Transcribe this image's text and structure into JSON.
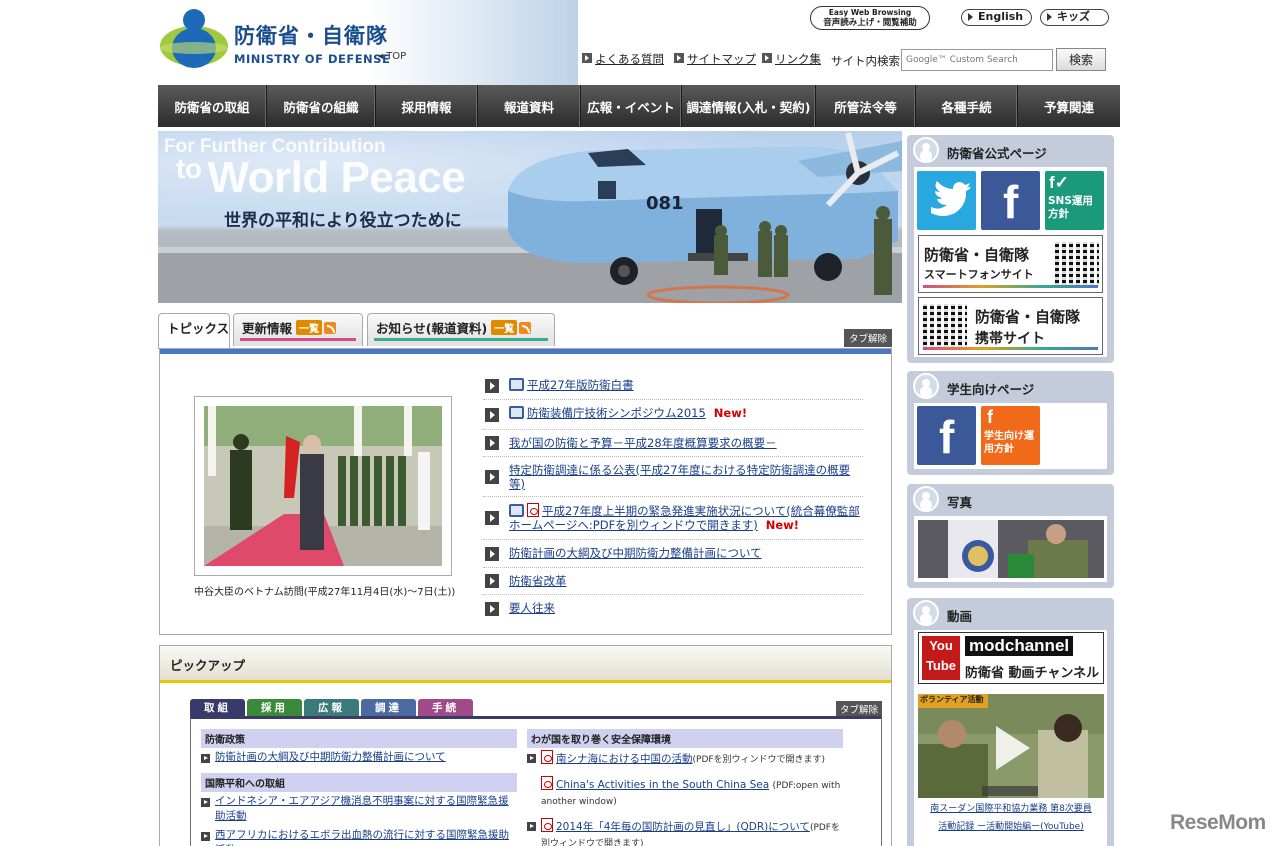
{
  "header": {
    "logo_jp": "防衛省・自衛隊",
    "logo_en": "MINISTRY OF DEFENSE",
    "top_link": "◂ TOP",
    "easy_web_line1": "Easy Web Browsing",
    "easy_web_line2": "音声読み上げ・閲覧補助",
    "english": "English",
    "kids": "キッズ",
    "links": [
      "よくある質問",
      "サイトマップ",
      "リンク集"
    ],
    "search_label": "サイト内検索",
    "search_placeholder": "Google™ Custom Search",
    "search_button": "検索"
  },
  "nav": [
    "防衛省の取組",
    "防衛省の組織",
    "採用情報",
    "報道資料",
    "広報・イベント",
    "調達情報(入札・契約)",
    "所管法令等",
    "各種手続",
    "予算関連"
  ],
  "hero": {
    "line1": "For Further Contribution",
    "line2_to": "to",
    "line2": "World Peace",
    "jp": "世界の平和により役立つために",
    "plane_number": "081"
  },
  "tabs": {
    "topics": "トピックス",
    "updates": "更新情報",
    "notices": "お知らせ(報道資料)",
    "list_label": "一覧",
    "release": "タブ解除"
  },
  "topics": {
    "photo_caption": "中谷大臣のベトナム訪問(平成27年11月4日(水)～7日(土))",
    "items": [
      {
        "text": "平成27年版防衛白書",
        "new": ""
      },
      {
        "text": "防衛装備庁技術シンポジウム2015",
        "new": "New!"
      },
      {
        "text": "我が国の防衛と予算－平成28年度概算要求の概要－",
        "new": ""
      },
      {
        "text": "特定防衛調達に係る公表(平成27年度における特定防衛調達の概要等)",
        "new": ""
      },
      {
        "text": "平成27年度上半期の緊急発進実施状況について(統合幕僚監部ホームページへ:PDFを別ウィンドウで開きます)",
        "new": "New!"
      },
      {
        "text": "防衛計画の大綱及び中期防衛力整備計画について",
        "new": ""
      },
      {
        "text": "防衛省改革",
        "new": ""
      },
      {
        "text": "要人往来",
        "new": ""
      }
    ]
  },
  "pickup": {
    "title": "ピックアップ",
    "tabs": [
      "取組",
      "採用",
      "広報",
      "調達",
      "手続"
    ],
    "release": "タブ解除",
    "left": {
      "head1": "防衛政策",
      "link1": "防衛計画の大綱及び中期防衛力整備計画について",
      "head2": "国際平和への取組",
      "link2": "インドネシア・エアアジア機消息不明事案に対する国際緊急援助活動",
      "link3": "西アフリカにおけるエボラ出血熱の流行に対する国際緊急援助活動"
    },
    "right": {
      "head1": "わが国を取り巻く安全保障環境",
      "link1": "南シナ海における中国の活動",
      "note1": "(PDFを別ウィンドウで開きます)",
      "link2": "China's Activities in the South China Sea",
      "note2": "(PDF:open with another window)",
      "link3": "2014年「4年毎の国防計画の見直し」(QDR)について",
      "note3": "(PDFを別ウィンドウで開きます)"
    }
  },
  "sidebar": {
    "official": "防衛省公式ページ",
    "sns_label": "SNS運用方針",
    "smartphone_jp": "防衛省・自衛隊",
    "smartphone_sub": "スマートフォンサイト",
    "mobile_jp": "防衛省・自衛隊",
    "mobile_sub": "携帯サイト",
    "student": "学生向けページ",
    "student_policy": "学生向け運用方針",
    "photo": "写真",
    "video": "動画",
    "mod_channel": "modchannel",
    "mod_channel_sub": "防衛省 動画チャンネル",
    "video_badge": "ボランティア活動",
    "video_caption1": "南スーダン国際平和協力業務 第8次要員",
    "video_caption2": "活動記録 ー活動開始編ー(YouTube)"
  },
  "watermark": "ReseMom"
}
